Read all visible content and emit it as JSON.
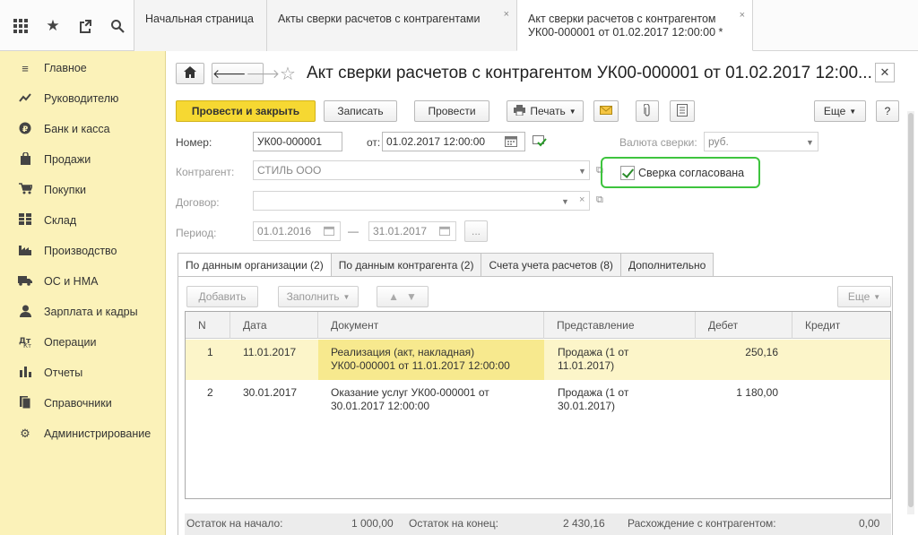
{
  "topbar": {
    "icons": [
      "apps-grid-icon",
      "star-icon",
      "history-icon",
      "search-icon"
    ],
    "tabs": [
      {
        "label": "Начальная страница"
      },
      {
        "label": "Акты сверки расчетов с контрагентами",
        "close": "×"
      },
      {
        "label_line1": "Акт сверки расчетов с контрагентом",
        "label_line2": "УК00-000001 от 01.02.2017 12:00:00 *",
        "close": "×"
      }
    ]
  },
  "sidebar": {
    "items": [
      {
        "label": "Главное",
        "icon": "menu-lines-icon"
      },
      {
        "label": "Руководителю",
        "icon": "trend-icon"
      },
      {
        "label": "Банк и касса",
        "icon": "ruble-icon"
      },
      {
        "label": "Продажи",
        "icon": "bag-icon"
      },
      {
        "label": "Покупки",
        "icon": "cart-icon"
      },
      {
        "label": "Склад",
        "icon": "warehouse-icon"
      },
      {
        "label": "Производство",
        "icon": "factory-icon"
      },
      {
        "label": "ОС и НМА",
        "icon": "truck-icon"
      },
      {
        "label": "Зарплата и кадры",
        "icon": "person-icon"
      },
      {
        "label": "Операции",
        "icon": "operations-icon"
      },
      {
        "label": "Отчеты",
        "icon": "bar-chart-icon"
      },
      {
        "label": "Справочники",
        "icon": "book-icon"
      },
      {
        "label": "Администрирование",
        "icon": "gear-icon"
      }
    ]
  },
  "doc": {
    "title": "Акт сверки расчетов с контрагентом УК00-000001 от 01.02.2017 12:00...",
    "toolbar": {
      "post_close": "Провести и закрыть",
      "save": "Записать",
      "post": "Провести",
      "print": "Печать",
      "more": "Еще",
      "help": "?"
    },
    "fields": {
      "number_label": "Номер:",
      "number_value": "УК00-000001",
      "date_label": "от:",
      "date_value": "01.02.2017 12:00:00",
      "currency_label": "Валюта сверки:",
      "currency_value": "руб.",
      "counterparty_label": "Контрагент:",
      "counterparty_value": "СТИЛЬ ООО",
      "agreed_label": "Сверка согласована",
      "contract_label": "Договор:",
      "contract_value": "",
      "period_label": "Период:",
      "period_from": "01.01.2016",
      "period_dash": "—",
      "period_to": "31.01.2017",
      "period_more": "..."
    },
    "tabs": [
      "По данным организации (2)",
      "По данным контрагента (2)",
      "Счета учета расчетов (8)",
      "Дополнительно"
    ],
    "table_toolbar": {
      "add": "Добавить",
      "fill": "Заполнить",
      "more": "Еще"
    },
    "table": {
      "columns": [
        "N",
        "Дата",
        "Документ",
        "Представление",
        "Дебет",
        "Кредит"
      ],
      "rows": [
        {
          "n": "1",
          "date": "11.01.2017",
          "doc1": "Реализация (акт, накладная)",
          "doc2": "УК00-000001 от 11.01.2017 12:00:00",
          "rep1": "Продажа (1 от",
          "rep2": "11.01.2017)",
          "debit": "250,16",
          "credit": ""
        },
        {
          "n": "2",
          "date": "30.01.2017",
          "doc1": "Оказание услуг УК00-000001 от",
          "doc2": "30.01.2017 12:00:00",
          "rep1": "Продажа (1 от",
          "rep2": "30.01.2017)",
          "debit": "1 180,00",
          "credit": ""
        }
      ]
    },
    "footer": {
      "start_label": "Остаток на начало:",
      "start_value": "1 000,00",
      "end_label": "Остаток на конец:",
      "end_value": "2 430,16",
      "diff_label": "Расхождение с контрагентом:",
      "diff_value": "0,00"
    }
  }
}
